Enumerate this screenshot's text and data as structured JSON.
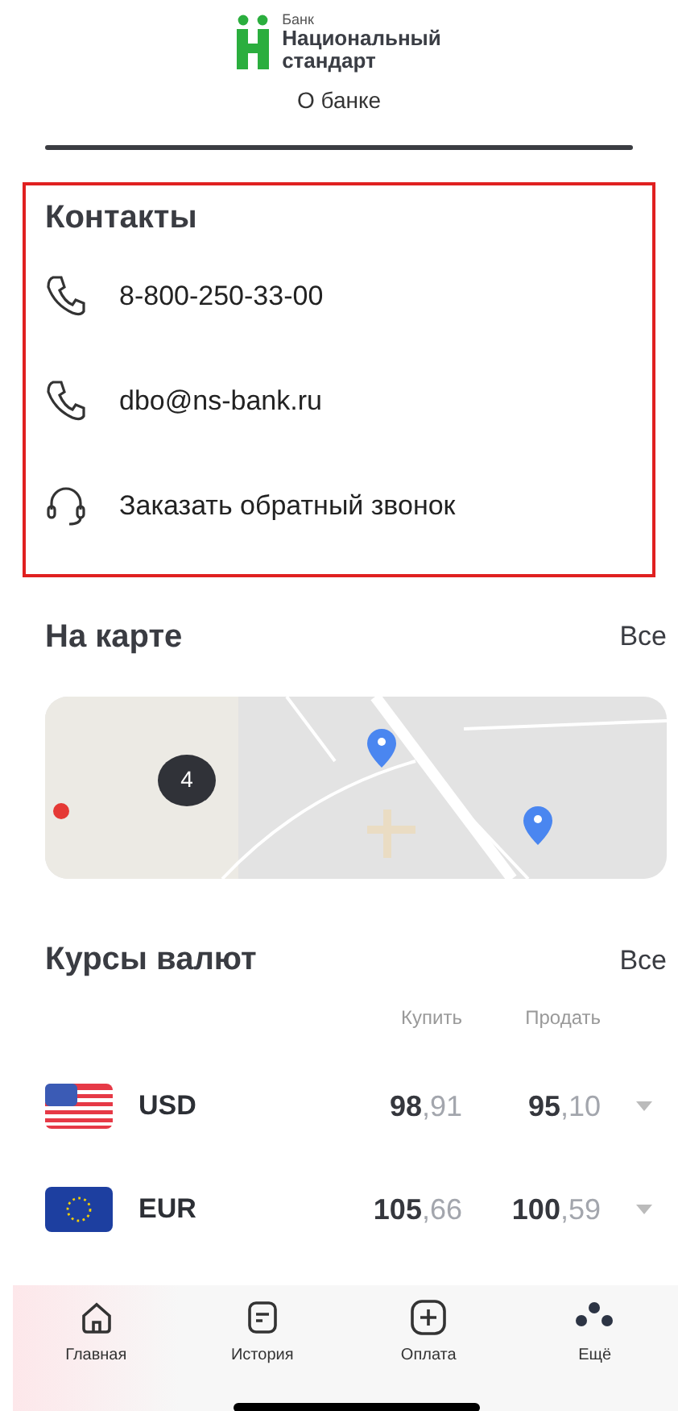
{
  "header": {
    "logo_top": "Банк",
    "logo_name": "Национальный",
    "logo_name2": "стандарт",
    "title": "О банке"
  },
  "contacts": {
    "title": "Контакты",
    "highlighted": true,
    "items": [
      {
        "kind": "phone",
        "label": "8-800-250-33-00"
      },
      {
        "kind": "phone",
        "label": "dbo@ns-bank.ru"
      },
      {
        "kind": "headset",
        "label": "Заказать обратный звонок"
      }
    ]
  },
  "map": {
    "title": "На карте",
    "all_link": "Все",
    "cluster": "4"
  },
  "rates": {
    "title": "Курсы валют",
    "all_link": "Все",
    "columns": [
      "Купить",
      "Продать"
    ],
    "rows": [
      {
        "code": "USD",
        "buy": "**98**,91",
        "sell": "**95**,10"
      },
      {
        "code": "EUR",
        "buy": "**105**,66",
        "sell": "**100**,59"
      }
    ]
  },
  "tabbar": [
    {
      "label": "Главная"
    },
    {
      "label": "История"
    },
    {
      "label": "Оплата"
    },
    {
      "label": "Ещё"
    }
  ]
}
